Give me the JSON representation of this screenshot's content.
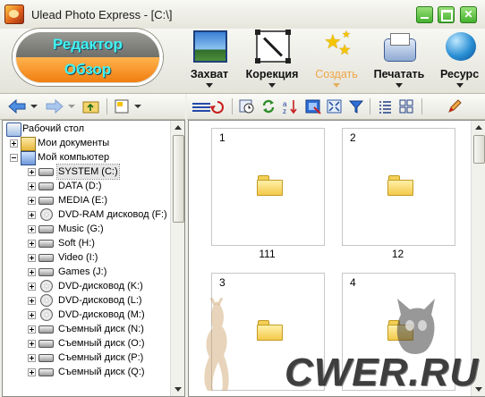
{
  "app": {
    "title": "Ulead Photo Express - [C:\\]"
  },
  "colors": {
    "mode_text": "#3ff2f2",
    "active_mode": "#f07e10",
    "disabled_tool": "#f0a646",
    "window_buttons": "#3fae2a"
  },
  "mode_switch": {
    "edit_label": "Редактор",
    "browse_label": "Обзор"
  },
  "tools": [
    {
      "label": "Захват",
      "icon": "capture-icon"
    },
    {
      "label": "Корекция",
      "icon": "correction-icon"
    },
    {
      "label": "Создать",
      "icon": "create-stars-icon",
      "disabled": true
    },
    {
      "label": "Печатать",
      "icon": "printer-icon"
    },
    {
      "label": "Ресурс",
      "icon": "globe-icon"
    }
  ],
  "tree": {
    "items": [
      {
        "label": "Рабочий стол",
        "icon": "desktop-icon"
      },
      {
        "label": "Мои документы",
        "icon": "my-documents-icon"
      },
      {
        "label": "Мой компьютер",
        "icon": "computer-icon"
      },
      {
        "label": "SYSTEM (C:)",
        "icon": "drive-icon",
        "selected": true
      },
      {
        "label": "DATA (D:)",
        "icon": "drive-icon"
      },
      {
        "label": "MEDIA (E:)",
        "icon": "drive-icon"
      },
      {
        "label": "DVD-RAM дисковод (F:)",
        "icon": "optical-drive-icon"
      },
      {
        "label": "Music (G:)",
        "icon": "drive-icon"
      },
      {
        "label": "Soft (H:)",
        "icon": "drive-icon"
      },
      {
        "label": "Video (I:)",
        "icon": "drive-icon"
      },
      {
        "label": "Games (J:)",
        "icon": "drive-icon"
      },
      {
        "label": "DVD-дисковод (K:)",
        "icon": "optical-drive-icon"
      },
      {
        "label": "DVD-дисковод (L:)",
        "icon": "optical-drive-icon"
      },
      {
        "label": "DVD-дисковод (M:)",
        "icon": "optical-drive-icon"
      },
      {
        "label": "Съемный диск (N:)",
        "icon": "drive-icon"
      },
      {
        "label": "Съемный диск (O:)",
        "icon": "drive-icon"
      },
      {
        "label": "Съемный диск (P:)",
        "icon": "drive-icon"
      },
      {
        "label": "Съемный диск (Q:)",
        "icon": "drive-icon"
      }
    ]
  },
  "thumbnails": [
    {
      "number": "1",
      "caption": "111"
    },
    {
      "number": "2",
      "caption": "12"
    },
    {
      "number": "3",
      "caption": ""
    },
    {
      "number": "4",
      "caption": ""
    }
  ],
  "watermark": {
    "text": "CWER.RU"
  }
}
